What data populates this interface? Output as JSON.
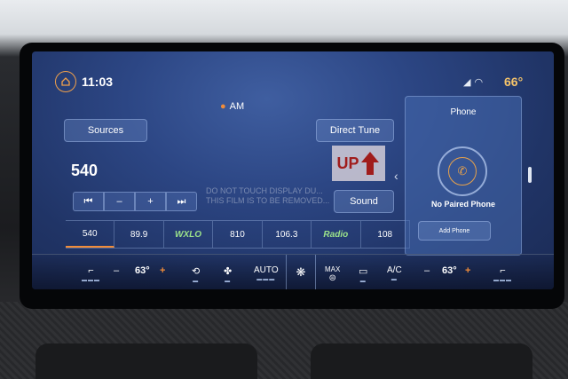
{
  "status": {
    "time": "11:03",
    "outside_temp": "66°",
    "icons": [
      "home-icon",
      "signal-icon",
      "wifi-icon"
    ]
  },
  "radio": {
    "band": "AM",
    "sources_label": "Sources",
    "direct_tune_label": "Direct Tune",
    "frequency": "540",
    "sound_label": "Sound",
    "controls": [
      "⏮",
      "–",
      "+",
      "⏭"
    ]
  },
  "sticker": {
    "text": "UP"
  },
  "film_note": {
    "line1": "DO NOT TOUCH DISPLAY DU...",
    "line2": "THIS FILM IS TO BE REMOVED..."
  },
  "presets": [
    "540",
    "89.9",
    "WXLO",
    "810",
    "106.3",
    "Radio",
    "108"
  ],
  "phone": {
    "title": "Phone",
    "status": "No Paired Phone",
    "add_label": "Add Phone"
  },
  "climate": {
    "left_temp": "63°",
    "right_temp": "63°",
    "auto_label": "AUTO",
    "max_label": "MAX",
    "ac_label": "A/C",
    "minus": "–",
    "plus": "+"
  },
  "colors": {
    "accent": "#f08c3a",
    "temp_text": "#f4c36a",
    "screen_bg": "#2c4684"
  }
}
